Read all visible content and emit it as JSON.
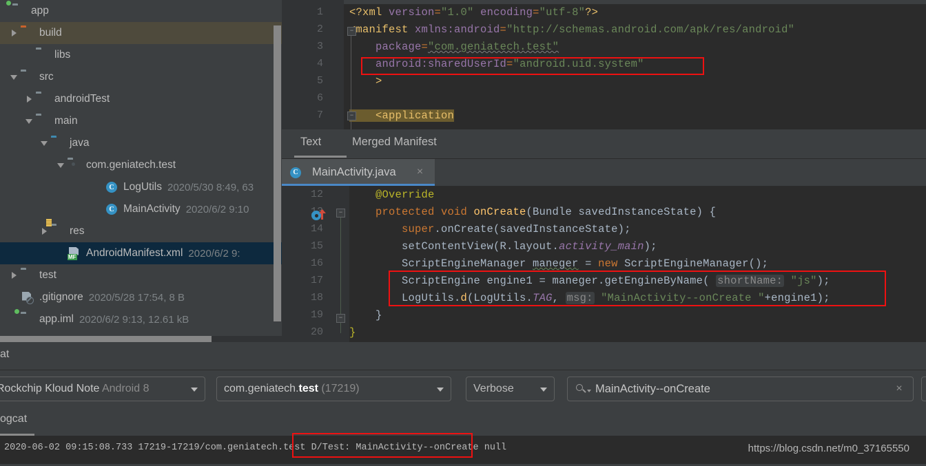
{
  "project": {
    "items": [
      {
        "arrow": "none",
        "icon": "module-folder",
        "label": "app",
        "meta": "",
        "indent": 2,
        "state": "normal"
      },
      {
        "arrow": "right",
        "icon": "folder-orange",
        "label": "build",
        "meta": "",
        "indent": 14,
        "state": "build-highlight"
      },
      {
        "arrow": "none",
        "icon": "folder",
        "label": "libs",
        "meta": "",
        "indent": 36,
        "state": "normal"
      },
      {
        "arrow": "down",
        "icon": "folder",
        "label": "src",
        "meta": "",
        "indent": 14,
        "state": "normal"
      },
      {
        "arrow": "right",
        "icon": "folder",
        "label": "androidTest",
        "meta": "",
        "indent": 36,
        "state": "normal"
      },
      {
        "arrow": "down",
        "icon": "folder",
        "label": "main",
        "meta": "",
        "indent": 36,
        "state": "normal"
      },
      {
        "arrow": "down",
        "icon": "folder-blue",
        "label": "java",
        "meta": "",
        "indent": 58,
        "state": "normal"
      },
      {
        "arrow": "down",
        "icon": "folder-package",
        "label": "com.geniatech.test",
        "meta": "",
        "indent": 82,
        "state": "normal"
      },
      {
        "arrow": "none",
        "icon": "java-class",
        "label": "LogUtils",
        "meta": "2020/5/30 8:49, 63",
        "indent": 136,
        "state": "normal"
      },
      {
        "arrow": "none",
        "icon": "java-class",
        "label": "MainActivity",
        "meta": "2020/6/2 9:10",
        "indent": 136,
        "state": "normal"
      },
      {
        "arrow": "right",
        "icon": "folder-res",
        "label": "res",
        "meta": "",
        "indent": 58,
        "state": "normal"
      },
      {
        "arrow": "none",
        "icon": "manifest-xml",
        "label": "AndroidManifest.xml",
        "meta": "2020/6/2 9:",
        "indent": 82,
        "state": "selected"
      },
      {
        "arrow": "right",
        "icon": "folder",
        "label": "test",
        "meta": "",
        "indent": 14,
        "state": "normal"
      },
      {
        "arrow": "none",
        "icon": "gitignore",
        "label": ".gitignore",
        "meta": "2020/5/28 17:54, 8 B",
        "indent": 14,
        "state": "normal"
      },
      {
        "arrow": "none",
        "icon": "module-folder",
        "label": "app.iml",
        "meta": "2020/6/2 9:13, 12.61 kB",
        "indent": 14,
        "state": "normal"
      }
    ]
  },
  "xml_editor": {
    "line_numbers": [
      "1",
      "2",
      "3",
      "4",
      "5",
      "6",
      "7"
    ],
    "lines": [
      {
        "n": "1",
        "segments": [
          {
            "t": "<?xml",
            "c": "k-tag"
          },
          {
            "t": " version",
            "c": "k-attr"
          },
          {
            "t": "=",
            "c": "k-punct"
          },
          {
            "t": "\"1.0\"",
            "c": "k-str"
          },
          {
            "t": " encoding",
            "c": "k-attr"
          },
          {
            "t": "=",
            "c": "k-punct"
          },
          {
            "t": "\"utf-8\"",
            "c": "k-str"
          },
          {
            "t": "?>",
            "c": "k-tag"
          }
        ]
      },
      {
        "n": "2",
        "segments": [
          {
            "t": "<manifest",
            "c": "k-tag"
          },
          {
            "t": " xmlns:android",
            "c": "k-attr"
          },
          {
            "t": "=",
            "c": "k-punct"
          },
          {
            "t": "\"http://schemas.android.com/apk/res/android\"",
            "c": "k-str"
          }
        ]
      },
      {
        "n": "3",
        "segments": [
          {
            "t": "    package",
            "c": "k-attr"
          },
          {
            "t": "=",
            "c": "k-punct"
          },
          {
            "t": "\"com.geniatech.test\"",
            "c": "k-str"
          }
        ]
      },
      {
        "n": "4",
        "segments": [
          {
            "t": "    android:sharedUserId",
            "c": "k-attr"
          },
          {
            "t": "=",
            "c": "k-punct"
          },
          {
            "t": "\"android.uid.system\"",
            "c": "k-str"
          }
        ]
      },
      {
        "n": "5",
        "segments": [
          {
            "t": "    >",
            "c": "k-tag"
          }
        ]
      },
      {
        "n": "6",
        "segments": []
      },
      {
        "n": "7",
        "segments": [
          {
            "t": "    <application",
            "c": "k-tag"
          }
        ]
      }
    ],
    "highlight_note": "line 7 <application is highlighted"
  },
  "manifest_tabs": {
    "text_tab": "Text",
    "merged_tab": "Merged Manifest",
    "active": "Text"
  },
  "editor_tab": {
    "label": "MainActivity.java",
    "icon": "java-class-icon",
    "close": "×"
  },
  "java_editor": {
    "lines": [
      {
        "n": "12",
        "segments": [
          {
            "t": "    @Override",
            "c": "j-anno"
          }
        ]
      },
      {
        "n": "13",
        "segments": [
          {
            "t": "    protected void ",
            "c": "j-kw"
          },
          {
            "t": "onCreate",
            "c": "j-method"
          },
          {
            "t": "(Bundle savedInstanceState) {",
            "c": "j-plain"
          }
        ]
      },
      {
        "n": "14",
        "segments": [
          {
            "t": "        ",
            "c": "j-plain"
          },
          {
            "t": "super",
            "c": "j-kw"
          },
          {
            "t": ".onCreate(savedInstanceState);",
            "c": "j-plain"
          }
        ]
      },
      {
        "n": "15",
        "segments": [
          {
            "t": "        setContentView(R.layout.",
            "c": "j-plain"
          },
          {
            "t": "activity_main",
            "c": "j-field"
          },
          {
            "t": ");",
            "c": "j-plain"
          }
        ]
      },
      {
        "n": "16",
        "segments": [
          {
            "t": "        ScriptEngineManager ",
            "c": "j-plain"
          },
          {
            "t": "maneger",
            "c": "j-plain j-warnline"
          },
          {
            "t": " = ",
            "c": "j-plain"
          },
          {
            "t": "new",
            "c": "j-kw"
          },
          {
            "t": " ScriptEngineManager();",
            "c": "j-plain"
          }
        ]
      },
      {
        "n": "17",
        "segments": [
          {
            "t": "        ScriptEngine engine1 = maneger.getEngineByName( ",
            "c": "j-plain"
          },
          {
            "t": "shortName:",
            "c": "j-hint"
          },
          {
            "t": " ",
            "c": "j-plain"
          },
          {
            "t": "\"js\"",
            "c": "j-str"
          },
          {
            "t": ");",
            "c": "j-plain"
          }
        ]
      },
      {
        "n": "18",
        "segments": [
          {
            "t": "        LogUtils.",
            "c": "j-plain"
          },
          {
            "t": "d",
            "c": "j-method"
          },
          {
            "t": "(LogUtils.",
            "c": "j-plain"
          },
          {
            "t": "TAG",
            "c": "j-static"
          },
          {
            "t": ", ",
            "c": "j-plain"
          },
          {
            "t": "msg:",
            "c": "j-hint"
          },
          {
            "t": " ",
            "c": "j-plain"
          },
          {
            "t": "\"MainActivity--onCreate \"",
            "c": "j-str"
          },
          {
            "t": "+engine1);",
            "c": "j-plain"
          }
        ]
      },
      {
        "n": "19",
        "segments": [
          {
            "t": "    }",
            "c": "j-plain"
          }
        ]
      },
      {
        "n": "20",
        "segments": [
          {
            "t": "}",
            "c": "j-anno"
          }
        ]
      }
    ]
  },
  "logcat": {
    "tab_label": "at",
    "panel_label": "ogcat",
    "device": {
      "name": "Rockchip Kloud Note",
      "os": "Android 8"
    },
    "process": {
      "package_prefix": "com.geniatech.",
      "package_bold": "test",
      "pid": "(17219)"
    },
    "level": "Verbose",
    "search": {
      "value": "MainActivity--onCreate",
      "clear": "×"
    },
    "output_line": "2020-06-02 09:15:08.733 17219-17219/com.geniatech.test D/Test: MainActivity--onCreate null"
  },
  "watermark": "https://blog.csdn.net/m0_37165550",
  "colors": {
    "accent_blue": "#4a88c7",
    "selection_blue": "#0d293e",
    "highlight_red": "#ee1111",
    "editor_bg": "#2b2b2b",
    "panel_bg": "#3c3f41"
  }
}
